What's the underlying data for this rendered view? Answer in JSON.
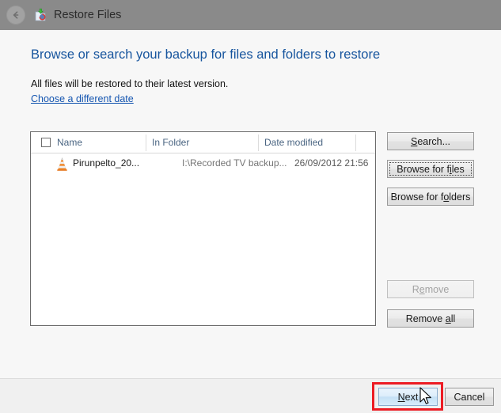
{
  "window": {
    "title": "Restore Files",
    "title_icon": "restore-files-icon",
    "back_icon": "back-arrow-icon",
    "titlebar_color": "#8a8a8a"
  },
  "page": {
    "heading": "Browse or search your backup for files and folders to restore",
    "subtext": "All files will be restored to their latest version.",
    "date_link": "Choose a different date",
    "heading_color": "#17559e",
    "link_color": "#1455b0"
  },
  "file_list": {
    "select_all_checkbox": "unchecked",
    "columns": [
      {
        "label": "Name"
      },
      {
        "label": "In Folder"
      },
      {
        "label": "Date modified"
      }
    ],
    "rows": [
      {
        "icon": "vlc-cone-icon",
        "name": "Pirunpelto_20...",
        "in_folder": "I:\\Recorded TV backup...",
        "date_modified": "26/09/2012 21:56"
      }
    ]
  },
  "side_buttons": [
    {
      "name": "search-button",
      "label": "Search...",
      "accel": "S",
      "enabled": true,
      "focused": false
    },
    {
      "name": "browse-for-files-button",
      "label": "Browse for files",
      "accel": "i",
      "enabled": true,
      "focused": true
    },
    {
      "name": "browse-for-folders-button",
      "label": "Browse for folders",
      "accel": "o",
      "enabled": true,
      "focused": false
    },
    {
      "name": "remove-button",
      "label": "Remove",
      "accel": "e",
      "enabled": false,
      "focused": false
    },
    {
      "name": "remove-all-button",
      "label": "Remove all",
      "accel": "a",
      "enabled": true,
      "focused": false
    }
  ],
  "footer": {
    "next_label": "Next",
    "next_accel": "N",
    "cancel_label": "Cancel",
    "highlight_color": "#ec1c24",
    "cursor": "arrow-cursor"
  }
}
